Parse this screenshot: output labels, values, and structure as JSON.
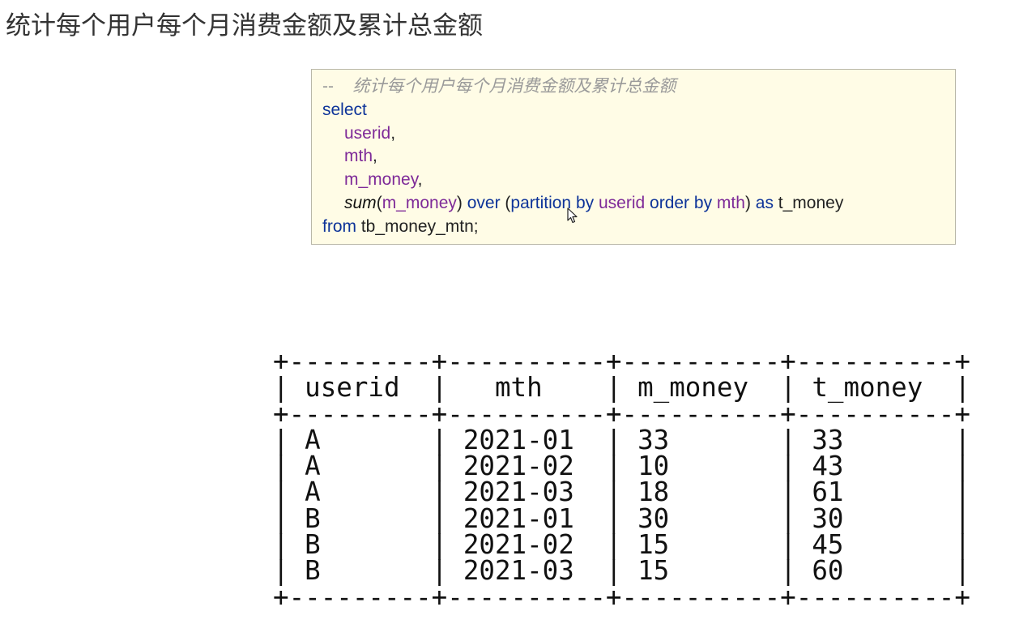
{
  "page": {
    "title": "统计每个用户每个月消费金额及累计总金额"
  },
  "code": {
    "comment_prefix": "--",
    "comment_text": "统计每个用户每个月消费金额及累计总金额",
    "select_kw": "select",
    "col1": "userid",
    "col2": "mth",
    "col3": "m_money",
    "sum_fn": "sum",
    "sum_arg": "m_money",
    "over_kw": "over",
    "partition_kw": "partition by",
    "partition_col": "userid",
    "order_kw": "order by",
    "order_col": "mth",
    "as_kw": "as",
    "alias": "t_money",
    "from_kw": "from",
    "table_name": "tb_money_mtn;"
  },
  "result": {
    "columns": [
      "userid",
      "mth",
      "m_money",
      "t_money"
    ],
    "rows": [
      [
        "A",
        "2021-01",
        "33",
        "33"
      ],
      [
        "A",
        "2021-02",
        "10",
        "43"
      ],
      [
        "A",
        "2021-03",
        "18",
        "61"
      ],
      [
        "B",
        "2021-01",
        "30",
        "30"
      ],
      [
        "B",
        "2021-02",
        "15",
        "45"
      ],
      [
        "B",
        "2021-03",
        "15",
        "60"
      ]
    ]
  },
  "colors": {
    "keyword": "#0d3399",
    "field": "#7e2a98",
    "comment": "#9a9a9a",
    "code_background": "#fffce6"
  },
  "icons": {
    "cursor": "mouse-pointer-icon"
  }
}
